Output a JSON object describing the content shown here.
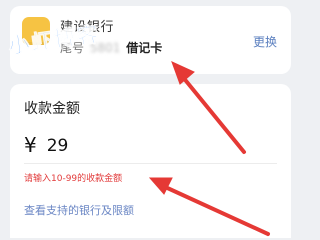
{
  "bank_card": {
    "bank_name": "建设银行",
    "tail_prefix": "尾号",
    "tail_number": "5801",
    "card_type": "借记卡",
    "change_label": "更换"
  },
  "watermark": "小虾博客",
  "amount": {
    "title": "收款金额",
    "currency_symbol": "¥",
    "value": "29",
    "error": "请输入10-99的收款金额"
  },
  "support_link": "查看支持的银行及限额",
  "colors": {
    "background": "#eef0f3",
    "link": "#5b7fbf",
    "error": "#e23c3c",
    "arrow": "#e53935",
    "logo": "#f6c343"
  }
}
